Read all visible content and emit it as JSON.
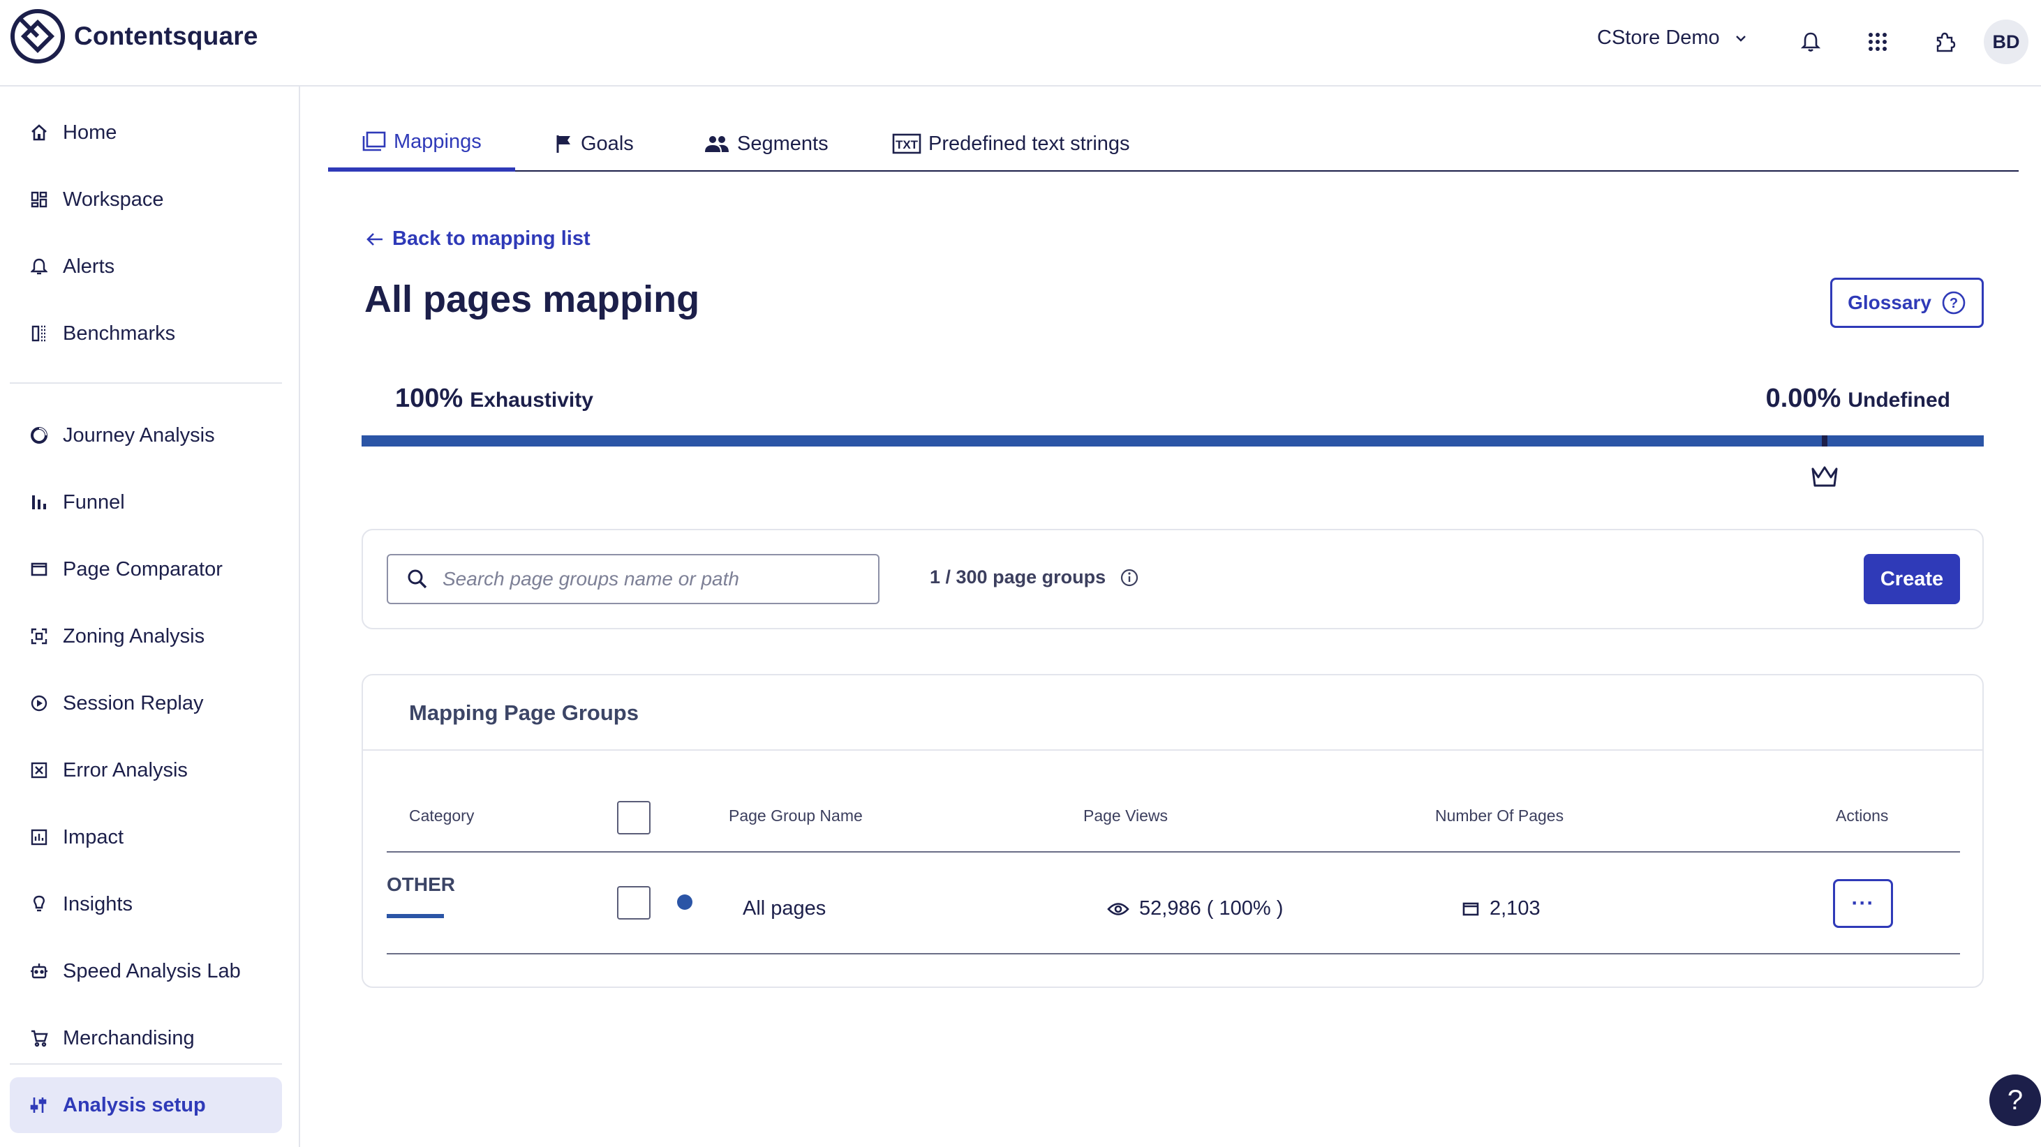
{
  "app": {
    "name": "Contentsquare",
    "brand_color": "#1c1f4a",
    "accent_color": "#2f3ab8"
  },
  "topbar": {
    "project": "CStore Demo",
    "avatar_initials": "BD",
    "icons": [
      "bell-icon",
      "apps-grid-icon",
      "puzzle-icon"
    ]
  },
  "sidebar": {
    "items": [
      {
        "label": "Home",
        "icon": "home-icon"
      },
      {
        "label": "Workspace",
        "icon": "workspace-icon"
      },
      {
        "label": "Alerts",
        "icon": "bell-icon"
      },
      {
        "label": "Benchmarks",
        "icon": "benchmarks-icon"
      },
      {
        "label": "Journey Analysis",
        "icon": "journey-icon"
      },
      {
        "label": "Funnel",
        "icon": "funnel-icon"
      },
      {
        "label": "Page Comparator",
        "icon": "page-comparator-icon"
      },
      {
        "label": "Zoning Analysis",
        "icon": "zoning-icon"
      },
      {
        "label": "Session Replay",
        "icon": "play-icon"
      },
      {
        "label": "Error Analysis",
        "icon": "error-icon"
      },
      {
        "label": "Impact",
        "icon": "impact-icon"
      },
      {
        "label": "Insights",
        "icon": "lightbulb-icon"
      },
      {
        "label": "Speed Analysis Lab",
        "icon": "robot-icon"
      },
      {
        "label": "Merchandising",
        "icon": "cart-icon"
      },
      {
        "label": "Analysis setup",
        "icon": "sliders-icon",
        "active": true
      }
    ]
  },
  "tabs": [
    {
      "label": "Mappings",
      "icon": "mappings-icon",
      "active": true
    },
    {
      "label": "Goals",
      "icon": "flag-icon"
    },
    {
      "label": "Segments",
      "icon": "people-icon"
    },
    {
      "label": "Predefined text strings",
      "icon": "txt-icon"
    }
  ],
  "main": {
    "back_link": "Back to mapping list",
    "title": "All pages mapping",
    "glossary_label": "Glossary",
    "exhaustivity": {
      "value": "100%",
      "label": "Exhaustivity",
      "fraction": 1.0
    },
    "undefined": {
      "value": "0.00%",
      "label": "Undefined"
    },
    "search": {
      "placeholder": "Search page groups name or path",
      "value": "",
      "count_text": "1 / 300 page groups",
      "create_label": "Create"
    },
    "groups": {
      "title": "Mapping Page Groups",
      "columns": [
        "Category",
        "Page Group Name",
        "Page Views",
        "Number Of Pages",
        "Actions"
      ],
      "rows": [
        {
          "category": "OTHER",
          "name": "All pages",
          "page_views": "52,986 ( 100% )",
          "pages": "2,103",
          "actions": "···"
        }
      ]
    }
  },
  "help_label": "?"
}
